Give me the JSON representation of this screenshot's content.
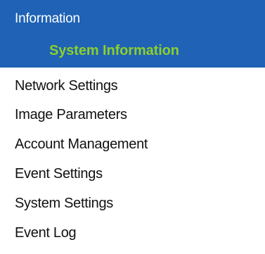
{
  "menu": {
    "section_label": "Information",
    "active_item": "System Information",
    "items": [
      "Network Settings",
      "Image Parameters",
      "Account Management",
      "Event Settings",
      "System Settings",
      "Event Log"
    ]
  },
  "colors": {
    "header_background": "#1f62b6",
    "header_text": "#ffffff",
    "active_text": "#8ccf2c",
    "item_text": "#111111"
  }
}
